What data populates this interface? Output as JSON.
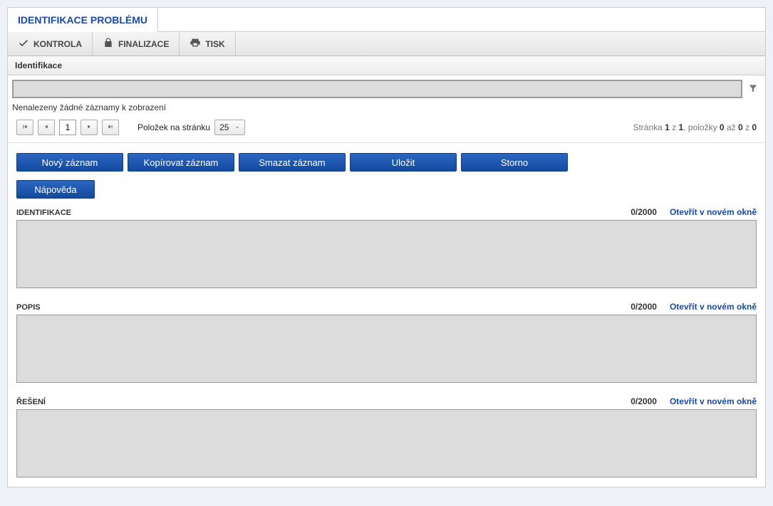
{
  "tab": {
    "title": "IDENTIFIKACE PROBLÉMU"
  },
  "toolbar": {
    "kontrola": "KONTROLA",
    "finalizace": "FINALIZACE",
    "tisk": "TISK"
  },
  "grid": {
    "header": "Identifikace",
    "no_records": "Nenalezeny žádné záznamy k zobrazení",
    "page_value": "1",
    "per_page_label": "Položek na stránku",
    "per_page_value": "25",
    "info_prefix": "Stránka ",
    "info_page": "1",
    "info_z": " z ",
    "info_total_pages": "1",
    "info_sep": ", položky ",
    "info_from": "0",
    "info_az": " až ",
    "info_to": "0",
    "info_z2": " z ",
    "info_total": "0"
  },
  "buttons": {
    "novy": "Nový záznam",
    "kopirovat": "Kopírovat záznam",
    "smazat": "Smazat záznam",
    "ulozit": "Uložit",
    "storno": "Storno",
    "napoveda": "Nápověda"
  },
  "fields": {
    "identifikace": {
      "label": "IDENTIFIKACE",
      "counter": "0/2000",
      "link": "Otevřít v novém okně"
    },
    "popis": {
      "label": "POPIS",
      "counter": "0/2000",
      "link": "Otevřít v novém okně"
    },
    "reseni": {
      "label": "ŘEŠENÍ",
      "counter": "0/2000",
      "link": "Otevřít v novém okně"
    }
  }
}
